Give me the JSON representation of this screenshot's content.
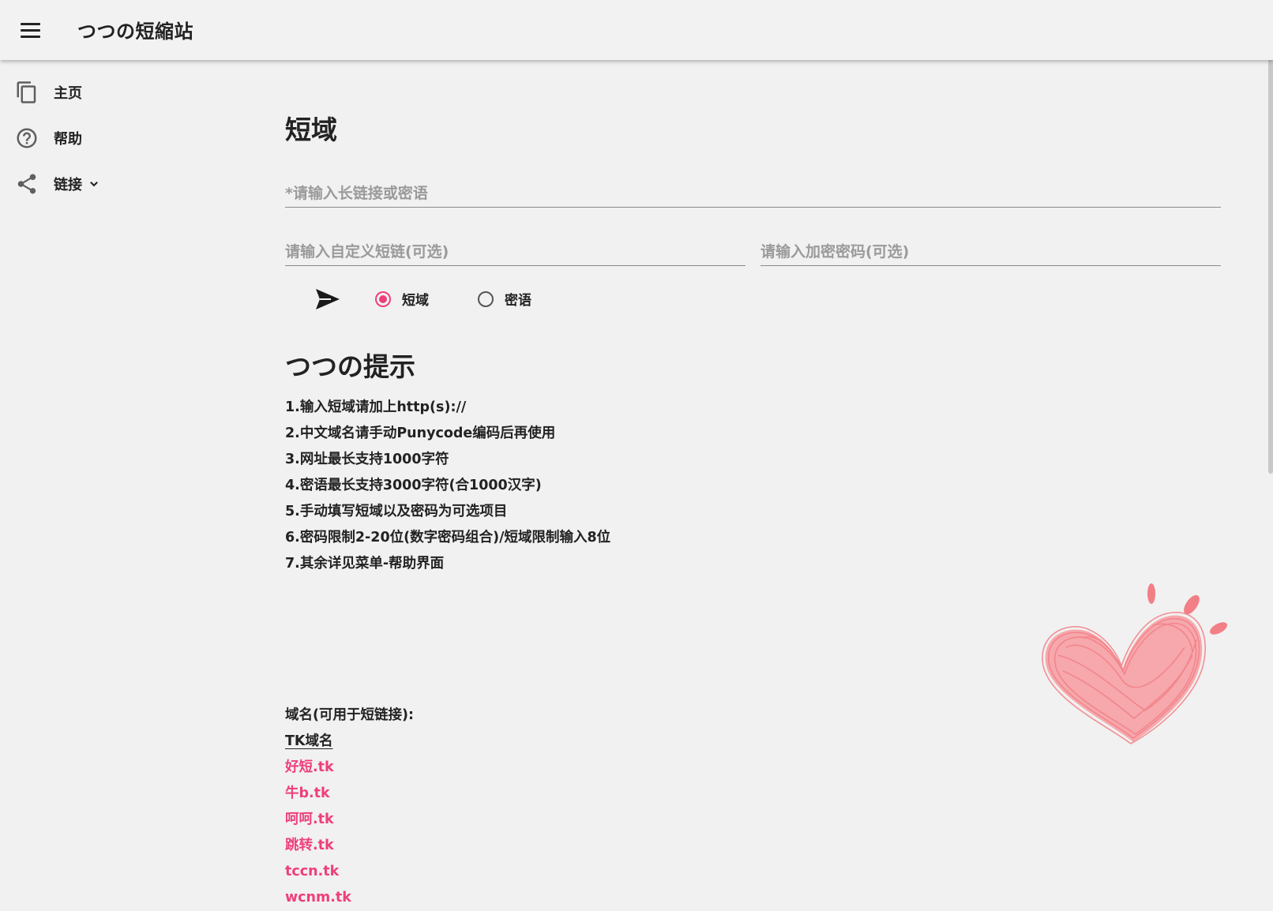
{
  "app": {
    "title": "つつの短縮站"
  },
  "sidebar": {
    "items": [
      {
        "label": "主页",
        "icon": "copy-pages-icon"
      },
      {
        "label": "帮助",
        "icon": "help-circle-icon"
      },
      {
        "label": "链接",
        "icon": "share-icon",
        "expandable": true
      }
    ]
  },
  "main": {
    "title": "短域",
    "long_url": {
      "placeholder": "*请输入长链接或密语",
      "value": ""
    },
    "custom_short": {
      "placeholder": "请输入自定义短链(可选)",
      "value": ""
    },
    "password": {
      "placeholder": "请输入加密密码(可选)",
      "value": ""
    },
    "mode": {
      "options": [
        "短域",
        "密语"
      ],
      "selected": "短域"
    }
  },
  "tips": {
    "title": "つつの提示",
    "items": [
      "1.输入短域请加上http(s)://",
      "2.中文域名请手动Punycode编码后再使用",
      "3.网址最长支持1000字符",
      "4.密语最长支持3000字符(合1000汉字)",
      "5.手动填写短域以及密码为可选项目",
      "6.密码限制2-20位(数字密码组合)/短域限制输入8位",
      "7.其余详见菜单-帮助界面"
    ]
  },
  "domains": {
    "heading": "域名(可用于短链接):",
    "group": "TK域名",
    "list": [
      "好短.tk",
      "牛b.tk",
      "呵呵.tk",
      "跳转.tk",
      "tccn.tk",
      "wcnm.tk"
    ]
  },
  "colors": {
    "accent": "#ee3f7c",
    "background": "#f1f1f1",
    "text": "#222222",
    "heart": "#f37f86"
  }
}
